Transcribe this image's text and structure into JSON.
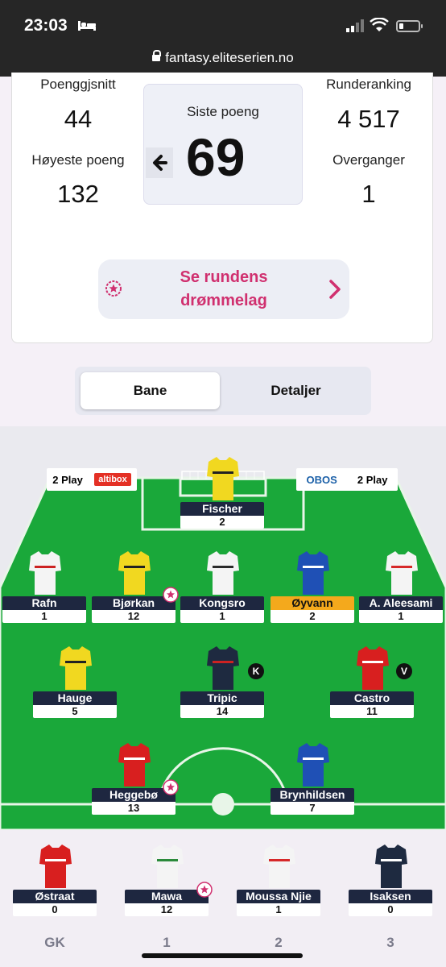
{
  "status_bar": {
    "time": "23:03",
    "url": "fantasy.eliteserien.no"
  },
  "stats": {
    "avg_label": "Poenggjsnitt",
    "avg_value": "44",
    "high_label": "Høyeste poeng",
    "high_value": "132",
    "rank_label": "Runderanking",
    "rank_value": "4 517",
    "transfers_label": "Overganger",
    "transfers_value": "1",
    "last_label": "Siste poeng",
    "last_value": "69"
  },
  "dream_team": {
    "label": "Se rundens drømmelag"
  },
  "tabs": {
    "pitch": "Bane",
    "details": "Detaljer"
  },
  "sponsors": {
    "left_a": "2 Play",
    "left_b": "altibox",
    "right_a": "OBOS",
    "right_b": "2 Play"
  },
  "players": [
    {
      "name": "Fischer",
      "points": "2",
      "shirt": "#f1d820",
      "trim": "#222"
    },
    {
      "name": "Rafn",
      "points": "1",
      "shirt": "#f4f4f4",
      "trim": "#c22"
    },
    {
      "name": "Bjørkan",
      "points": "12",
      "shirt": "#f1d820",
      "trim": "#222"
    },
    {
      "name": "Kongsro",
      "points": "1",
      "shirt": "#f4f4f4",
      "trim": "#2a2a2a"
    },
    {
      "name": "Øyvann",
      "points": "2",
      "shirt": "#1f50b5",
      "trim": "#fff"
    },
    {
      "name": "A. Aleesami",
      "points": "1",
      "shirt": "#f4f4f4",
      "trim": "#d62929"
    },
    {
      "name": "Hauge",
      "points": "5",
      "shirt": "#f1d820",
      "trim": "#222"
    },
    {
      "name": "Tripic",
      "points": "14",
      "shirt": "#1e2a40",
      "trim": "#c22"
    },
    {
      "name": "Castro",
      "points": "11",
      "shirt": "#d81f1f",
      "trim": "#fff"
    },
    {
      "name": "Heggebø",
      "points": "13",
      "shirt": "#d81f1f",
      "trim": "#fff"
    },
    {
      "name": "Brynhildsen",
      "points": "7",
      "shirt": "#1f50b5",
      "trim": "#fff"
    }
  ],
  "bench": [
    {
      "name": "Østraat",
      "points": "0",
      "label": "GK",
      "shirt": "#d81f1f",
      "trim": "#fff"
    },
    {
      "name": "Mawa",
      "points": "12",
      "label": "1",
      "shirt": "#f4f4f4",
      "trim": "#2a8a3a"
    },
    {
      "name": "Moussa Njie",
      "points": "1",
      "label": "2",
      "shirt": "#f4f4f4",
      "trim": "#d62929"
    },
    {
      "name": "Isaksen",
      "points": "0",
      "label": "3",
      "shirt": "#1e2a40",
      "trim": "#fff"
    }
  ],
  "badges": {
    "captain": "K",
    "vice": "V"
  },
  "colors": {
    "accent": "#d0306f",
    "pitch": "#1aa83a",
    "nameplate": "#1e2740",
    "highlight": "#f4a91c"
  }
}
